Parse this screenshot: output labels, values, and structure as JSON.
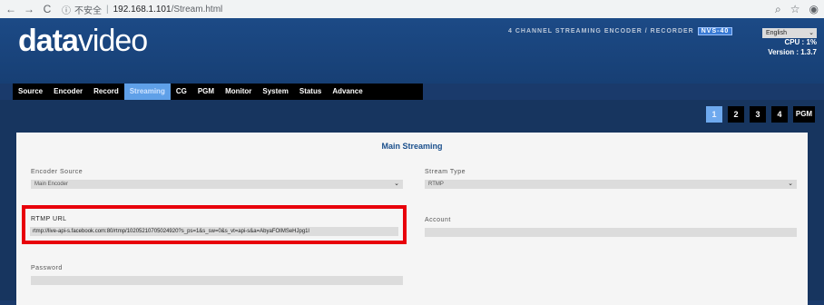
{
  "browser": {
    "back": "←",
    "forward": "→",
    "reload": "C",
    "insecure_icon": "ⓘ",
    "insecure_text": "不安全",
    "separator": "|",
    "host": "192.168.1.101",
    "path": "/Stream.html",
    "zoom_icon": "⌕",
    "star_icon": "☆",
    "profile_icon": "◉"
  },
  "header": {
    "logo_bold": "data",
    "logo_light": "video",
    "product_line": "4 CHANNEL STREAMING ENCODER / RECORDER",
    "model": "NVS-40",
    "language": "English",
    "language_caret": "⌄",
    "cpu": "CPU : 1%",
    "version": "Version : 1.3.7"
  },
  "tabs": [
    {
      "label": "Source"
    },
    {
      "label": "Encoder"
    },
    {
      "label": "Record"
    },
    {
      "label": "Streaming"
    },
    {
      "label": "CG"
    },
    {
      "label": "PGM"
    },
    {
      "label": "Monitor"
    },
    {
      "label": "System"
    },
    {
      "label": "Status"
    },
    {
      "label": "Advance"
    }
  ],
  "active_tab": "Streaming",
  "pager": [
    "1",
    "2",
    "3",
    "4",
    "PGM"
  ],
  "panel": {
    "title": "Main Streaming",
    "encoder_source_label": "Encoder Source",
    "encoder_source_value": "Main Encoder",
    "stream_type_label": "Stream Type",
    "stream_type_value": "RTMP",
    "rtmp_url_label": "RTMP URL",
    "rtmp_url_value": "rtmp://live-api-s.facebook.com:80/rtmp/10205210705024920?s_ps=1&s_sw=0&s_vt=api-s&a=AbyaFOIMSeHJpg1l",
    "account_label": "Account",
    "account_value": "",
    "password_label": "Password",
    "password_value": "",
    "caret": "⌄"
  },
  "colors": {
    "header_bg": "#1c4a86",
    "active_tab": "#5fa0e8",
    "highlight": "#e8000b",
    "title": "#1a4f8c"
  }
}
